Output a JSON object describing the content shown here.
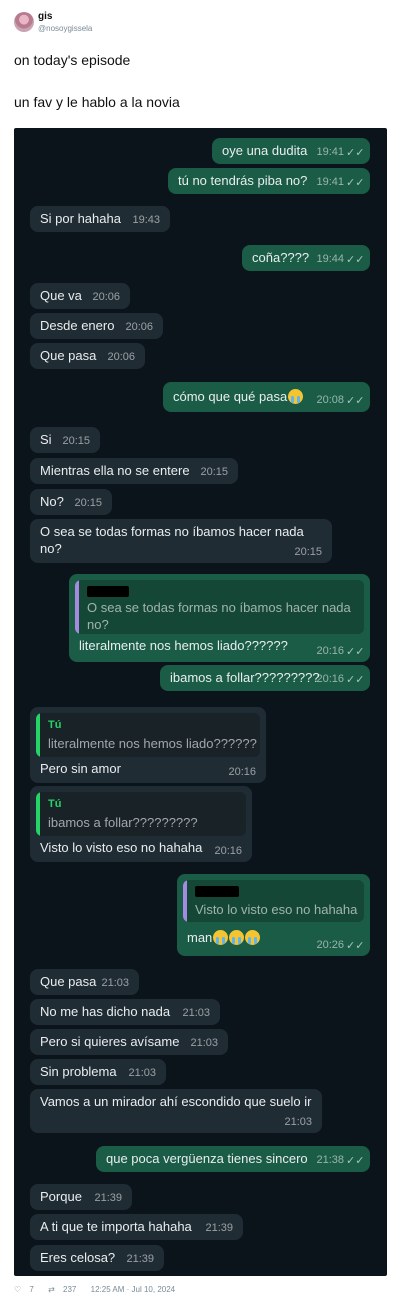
{
  "tweet": {
    "name": "gis",
    "handle": "@nosoygissela",
    "line1": "on today's episode",
    "line2": "un fav y le hablo a la novia"
  },
  "messages": [
    {
      "dir": "out",
      "text": "oye una dudita",
      "time": "19:41"
    },
    {
      "dir": "out",
      "text": "tú no tendrás piba no?",
      "time": "19:41"
    },
    {
      "dir": "in",
      "text": "Si por hahaha",
      "time": "19:43"
    },
    {
      "dir": "out",
      "text": "coña????",
      "time": "19:44"
    },
    {
      "dir": "in",
      "text": "Que va",
      "time": "20:06"
    },
    {
      "dir": "in",
      "text": "Desde enero",
      "time": "20:06"
    },
    {
      "dir": "in",
      "text": "Que pasa",
      "time": "20:06"
    },
    {
      "dir": "out",
      "text": "cómo que qué pasa",
      "emoji": "loudly-crying-face",
      "time": "20:08"
    },
    {
      "dir": "in",
      "text": "Si",
      "time": "20:15"
    },
    {
      "dir": "in",
      "text": "Mientras ella no se entere",
      "time": "20:15"
    },
    {
      "dir": "in",
      "text": "No?",
      "time": "20:15"
    },
    {
      "dir": "in",
      "text": "O sea se todas formas no íbamos hacer nada",
      "text2": "no?",
      "time": "20:15"
    },
    {
      "dir": "out",
      "quote": "O sea se todas formas no íbamos hacer nada",
      "quote2": "no?",
      "text": "literalmente nos hemos liado??????",
      "time": "20:16"
    },
    {
      "dir": "out",
      "text": "ibamos a follar?????????",
      "time": "20:16"
    },
    {
      "dir": "in",
      "quote_name": "Tú",
      "quote": "literalmente nos hemos liado??????",
      "text": "Pero sin amor",
      "time": "20:16"
    },
    {
      "dir": "in",
      "quote_name": "Tú",
      "quote": "ibamos a follar?????????",
      "text": "Visto lo visto eso no hahaha",
      "time": "20:16"
    },
    {
      "dir": "out",
      "quote": "Visto lo visto eso no hahaha",
      "text": "man",
      "time": "20:26"
    },
    {
      "dir": "in",
      "text": "Que pasa",
      "time": "21:03"
    },
    {
      "dir": "in",
      "text": "No me has dicho nada",
      "time": "21:03"
    },
    {
      "dir": "in",
      "text": "Pero si quieres avísame",
      "time": "21:03"
    },
    {
      "dir": "in",
      "text": "Sin problema",
      "time": "21:03"
    },
    {
      "dir": "in",
      "text": "Vamos a un mirador ahí escondido que suelo ir",
      "time": "21:03"
    },
    {
      "dir": "out",
      "text": "que poca vergüenza tienes sincero",
      "time": "21:38"
    },
    {
      "dir": "in",
      "text": "Porque",
      "time": "21:39"
    },
    {
      "dir": "in",
      "text": "A ti que te importa hahaha",
      "time": "21:39"
    },
    {
      "dir": "in",
      "text": "Eres celosa?",
      "time": "21:39"
    }
  ],
  "footer": {
    "likes": "7",
    "retweets": "237",
    "datetime": "12:25 AM · Jul 10, 2024"
  },
  "colors": {
    "chat_bg": "#0b141a",
    "incoming": "#202c33",
    "outgoing": "#1a5c45",
    "quote_accent_in": "#25d366",
    "quote_accent_out": "#a48be0"
  }
}
